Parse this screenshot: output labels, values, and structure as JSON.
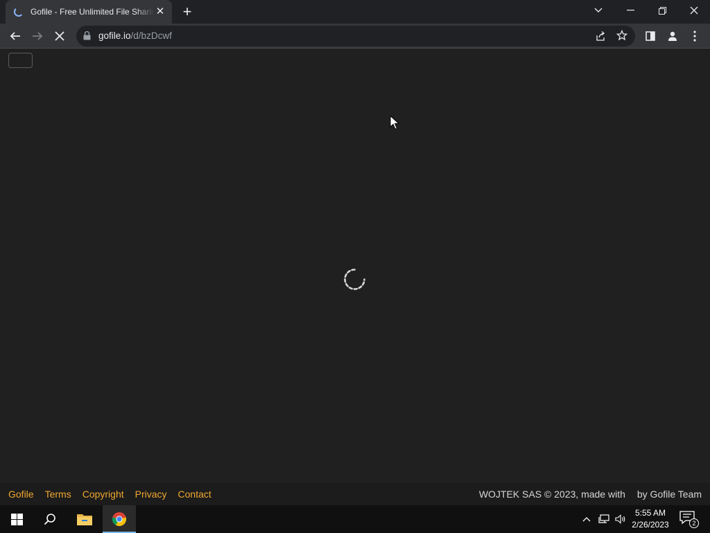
{
  "browser": {
    "tab": {
      "title": "Gofile - Free Unlimited File Sharing",
      "close_icon": "close-icon",
      "loading_icon": "spinner-icon"
    },
    "new_tab_icon": "plus-icon",
    "window_controls": [
      "tab-search-icon",
      "minimize-icon",
      "restore-icon",
      "close-icon"
    ],
    "toolbar": {
      "back_icon": "arrow-left-icon",
      "forward_icon": "arrow-right-icon",
      "stop_icon": "stop-loading-icon",
      "url_host": "gofile.io",
      "url_path": "/d/bzDcwf",
      "lock_icon": "lock-icon",
      "share_icon": "share-icon",
      "bookmark_icon": "star-icon",
      "side_panel_icon": "side-panel-icon",
      "profile_icon": "profile-icon",
      "menu_icon": "kebab-menu-icon"
    }
  },
  "page": {
    "loading": true,
    "footer": {
      "links": [
        "Gofile",
        "Terms",
        "Copyright",
        "Privacy",
        "Contact"
      ],
      "credit_left": "WOJTEK SAS © 2023, made with",
      "credit_right": "by Gofile Team"
    }
  },
  "taskbar": {
    "apps": [
      "windows-start-icon",
      "search-icon",
      "file-explorer-icon",
      "chrome-icon"
    ],
    "active_app": "chrome-icon",
    "tray": [
      "chevron-up-icon",
      "network-icon",
      "volume-icon"
    ],
    "time": "5:55 AM",
    "date": "2/26/2023",
    "notification_count": "2"
  },
  "colors": {
    "link": "#f0a830",
    "page_bg": "#202020",
    "footer_bg": "#1c1c1c",
    "taskbar_bg": "#101010",
    "active_indicator": "#76b9ed"
  }
}
